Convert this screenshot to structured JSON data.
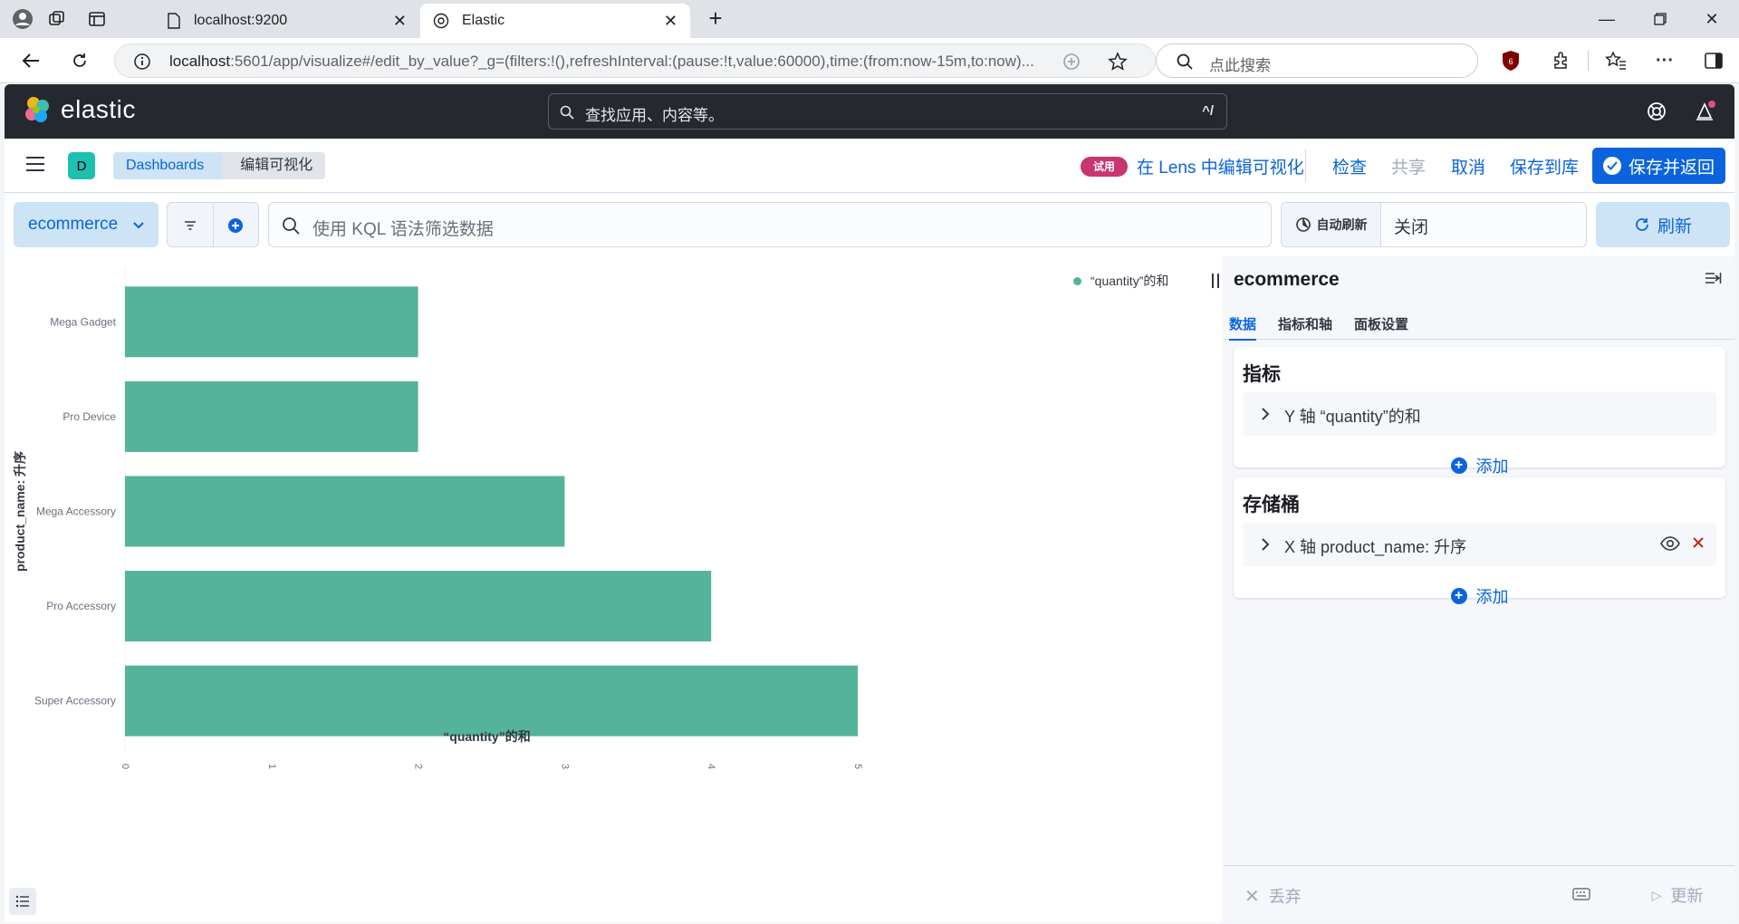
{
  "browser": {
    "tabs": [
      {
        "title": "localhost:9200",
        "active": false
      },
      {
        "title": "Elastic",
        "active": true
      }
    ],
    "url_host": "localhost",
    "url_rest": ":5601/app/visualize#/edit_by_value?_g=(filters:!(),refreshInterval:(pause:!t,value:60000),time:(from:now-15m,to:now)...",
    "search_placeholder": "点此搜索"
  },
  "kibana": {
    "brand": "elastic",
    "global_search_placeholder": "查找应用、内容等。",
    "global_search_shortcut": "^/"
  },
  "app_bar": {
    "space_initial": "D",
    "breadcrumbs": [
      "Dashboards",
      "编辑可视化"
    ],
    "trial_badge": "试用",
    "lens_link": "在 Lens 中编辑可视化",
    "inspect": "检查",
    "share": "共享",
    "cancel": "取消",
    "save_to_library": "保存到库",
    "save_and_return": "保存并返回"
  },
  "query_bar": {
    "data_view": "ecommerce",
    "kql_placeholder": "使用 KQL 语法筛选数据",
    "auto_refresh_label": "自动刷新",
    "auto_refresh_value": "关闭",
    "refresh_label": "刷新"
  },
  "chart_data": {
    "type": "bar",
    "orientation": "horizontal",
    "categories": [
      "Mega Gadget",
      "Pro Device",
      "Mega Accessory",
      "Pro Accessory",
      "Super Accessory"
    ],
    "series": [
      {
        "name": "“quantity”的和",
        "values": [
          2,
          2,
          3,
          4,
          5
        ],
        "color": "#54b399"
      }
    ],
    "xlabel": "“quantity”的和",
    "ylabel": "product_name: 升序",
    "xlim": [
      0,
      5
    ],
    "xticks": [
      "0",
      "1",
      "2",
      "3",
      "4",
      "5"
    ],
    "legend_position": "top-right"
  },
  "editor": {
    "title": "ecommerce",
    "tabs": [
      "数据",
      "指标和轴",
      "面板设置"
    ],
    "metrics": {
      "title": "指标",
      "item": "Y 轴 “quantity”的和",
      "add": "添加"
    },
    "buckets": {
      "title": "存储桶",
      "item": "X 轴 product_name: 升序",
      "add": "添加"
    },
    "discard": "丢弃",
    "update": "更新"
  },
  "colors": {
    "accent": "#0b64dd",
    "bar": "#54b399",
    "trial": "#c9356e",
    "header": "#25282f"
  }
}
